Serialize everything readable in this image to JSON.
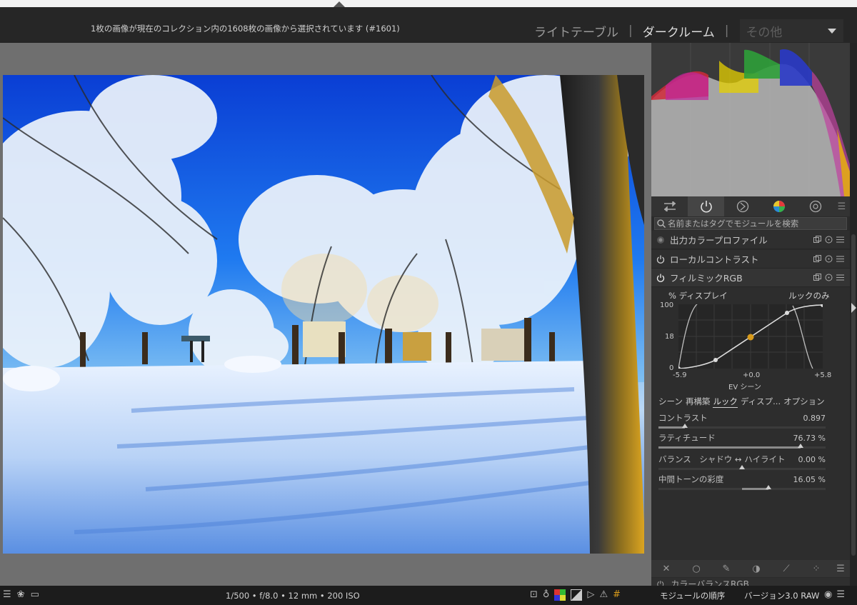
{
  "header": {
    "status": "1枚の画像が現在のコレクション内の1608枚の画像から選択されています (#1601)",
    "views": [
      "ライトテーブル",
      "ダークルーム"
    ],
    "separator": "|",
    "other": "その他"
  },
  "search": {
    "placeholder": "名前またはタグでモジュールを検索"
  },
  "modules": [
    {
      "name": "出力カラープロファイル"
    },
    {
      "name": "ローカルコントラスト"
    },
    {
      "name": "フィルミックRGB"
    }
  ],
  "filmic": {
    "y_label": "% ディスプレイ",
    "look_label": "ルックのみ",
    "y_ticks": [
      "100",
      "18",
      "0"
    ],
    "x_ticks": [
      "-5.9",
      "+0.0",
      "+5.8"
    ],
    "x_label": "EV シーン",
    "tabs": [
      "シーン",
      "再構築",
      "ルック",
      "ディスプ...",
      "オプション"
    ],
    "active_tab": "ルック",
    "sliders": [
      {
        "label": "コントラスト",
        "value": "0.897",
        "fraction": 0.16
      },
      {
        "label": "ラティチュード",
        "value": "76.73 %",
        "fraction": 0.85
      },
      {
        "label": "バランス　シャドウ ↔ ハイライト",
        "value": "0.00 %",
        "fraction": 0.5
      },
      {
        "label": "中間トーンの彩度",
        "value": "16.05 %",
        "fraction": 0.66
      }
    ]
  },
  "next_module": "カラーバランスRGB",
  "bottom": {
    "exif": "1/500 • f/8.0 • 12 mm • 200 ISO",
    "module_order": "モジュールの順序",
    "version": "バージョン3.0 RAW"
  },
  "colors": {
    "accent_orange": "#d79a1b",
    "panel": "#2b2b2b",
    "sky": "#1a6ff2"
  }
}
